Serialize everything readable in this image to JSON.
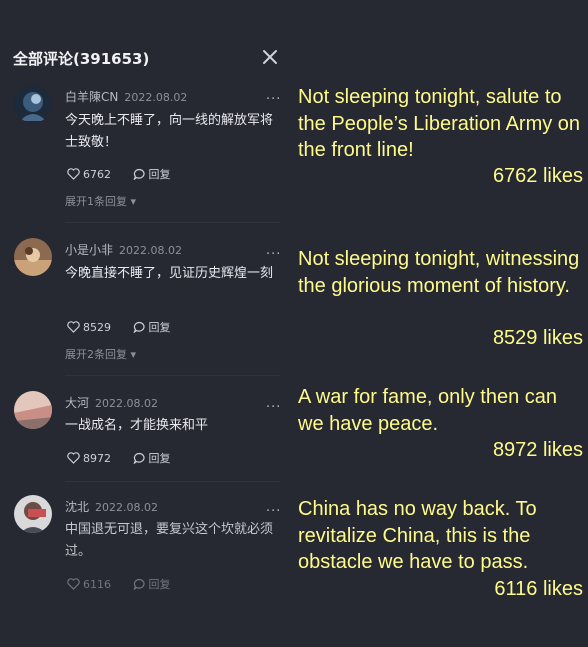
{
  "header": {
    "title": "全部评论(391653)",
    "close_icon": "close-icon"
  },
  "comments": [
    {
      "user": "白羊陳CN",
      "date": "2022.08.02",
      "more": "...",
      "text": "今天晚上不睡了，向一线的解放军将士致敬！",
      "likes": "6762",
      "reply_label": "回复",
      "expand": "展开1条回复 ▾",
      "translation": "Not sleeping tonight, salute to the People’s Liberation Army on the front line!",
      "likes_note": "6762 likes"
    },
    {
      "user": "小是小非",
      "date": "2022.08.02",
      "more": "...",
      "text": "今晚直接不睡了，见证历史辉煌一刻",
      "likes": "8529",
      "reply_label": "回复",
      "expand": "展开2条回复 ▾",
      "translation": "Not sleeping tonight, witnessing the glorious moment of history.",
      "likes_note": "8529 likes"
    },
    {
      "user": "大河",
      "date": "2022.08.02",
      "more": "...",
      "text": "一战成名，才能换来和平",
      "likes": "8972",
      "reply_label": "回复",
      "translation": "A war for fame, only then can we have peace.",
      "likes_note": "8972 likes"
    },
    {
      "user": "沈北",
      "date": "2022.08.02",
      "more": "...",
      "text": "中国退无可退，要复兴这个坎就必须过。",
      "likes": "6116",
      "reply_label": "回复",
      "translation": "China has no way back. To revitalize China, this is the obstacle we have to pass.",
      "likes_note": "6116 likes"
    }
  ],
  "colors": {
    "background": "#262832",
    "translation": "#fffb8a"
  }
}
